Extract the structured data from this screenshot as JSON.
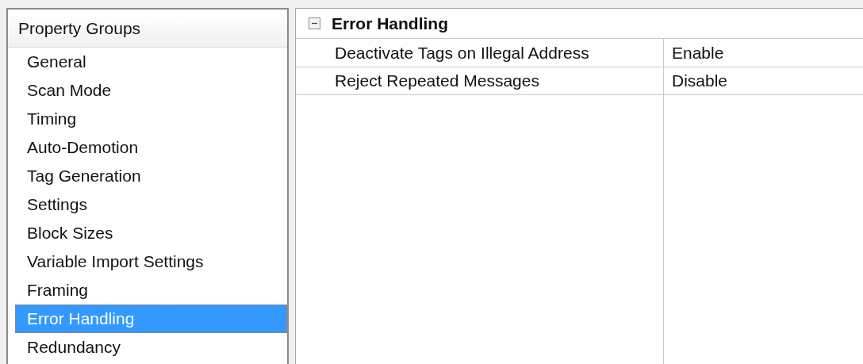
{
  "property_groups": {
    "title": "Property Groups",
    "items": [
      {
        "label": "General",
        "selected": false
      },
      {
        "label": "Scan Mode",
        "selected": false
      },
      {
        "label": "Timing",
        "selected": false
      },
      {
        "label": "Auto-Demotion",
        "selected": false
      },
      {
        "label": "Tag Generation",
        "selected": false
      },
      {
        "label": "Settings",
        "selected": false
      },
      {
        "label": "Block Sizes",
        "selected": false
      },
      {
        "label": "Variable Import Settings",
        "selected": false
      },
      {
        "label": "Framing",
        "selected": false
      },
      {
        "label": "Error Handling",
        "selected": true
      },
      {
        "label": "Redundancy",
        "selected": false
      }
    ]
  },
  "property_grid": {
    "category": {
      "title": "Error Handling",
      "expanded": true
    },
    "rows": [
      {
        "name": "Deactivate Tags on Illegal Address",
        "value": "Enable"
      },
      {
        "name": "Reject Repeated Messages",
        "value": "Disable"
      }
    ]
  }
}
